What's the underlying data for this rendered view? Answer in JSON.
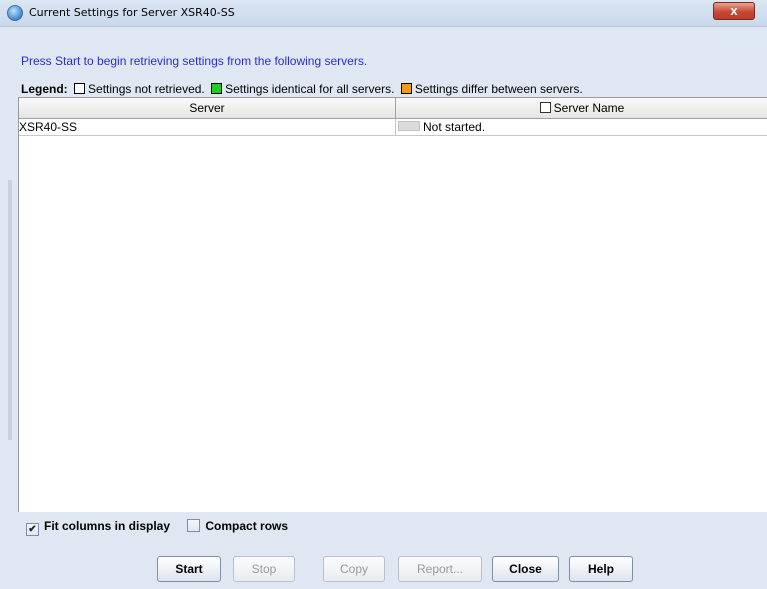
{
  "window": {
    "title": "Current Settings for Server XSR40-SS",
    "close_label": "x"
  },
  "instruction": "Press Start to begin retrieving settings from the following servers.",
  "legend": {
    "label": "Legend:",
    "items": [
      {
        "text": "Settings not retrieved.",
        "color": "#ffffff"
      },
      {
        "text": "Settings identical for all servers.",
        "color": "#22cc22"
      },
      {
        "text": "Settings differ between servers.",
        "color": "#f39a14"
      }
    ]
  },
  "table": {
    "columns": [
      "Server",
      "Server Name"
    ],
    "rows": [
      {
        "server": "XSR40-SS",
        "status": "Not started."
      }
    ]
  },
  "options": {
    "fit_columns": {
      "label": "Fit columns in display",
      "checked": true
    },
    "compact_rows": {
      "label": "Compact rows",
      "checked": false
    }
  },
  "buttons": {
    "start": "Start",
    "stop": "Stop",
    "copy": "Copy",
    "report": "Report...",
    "close": "Close",
    "help": "Help"
  }
}
